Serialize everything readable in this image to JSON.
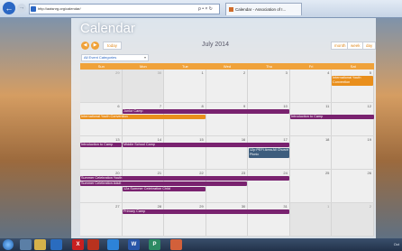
{
  "browser": {
    "back_glyph": "←",
    "forward_glyph": "→",
    "address": "http://aaisnrg.org/calendar/",
    "address_controls": "ρ • × ↻",
    "tab_title": "Calendar - Association of I...",
    "tab_close": "×"
  },
  "page": {
    "title": "Calendar",
    "prev_glyph": "◀",
    "next_glyph": "▶",
    "today_label": "today",
    "month_title": "July 2014",
    "view_month": "month",
    "view_week": "week",
    "view_day": "day",
    "category_value": "All Event Categories",
    "category_chevron": "▾"
  },
  "day_names": [
    "Sun",
    "Mon",
    "Tue",
    "Wed",
    "Thu",
    "Fri",
    "Sat"
  ],
  "weeks": [
    [
      "29",
      "30",
      "1",
      "2",
      "3",
      "4",
      "5"
    ],
    [
      "6",
      "7",
      "8",
      "9",
      "10",
      "11",
      "12"
    ],
    [
      "13",
      "14",
      "15",
      "16",
      "17",
      "18",
      "19"
    ],
    [
      "20",
      "21",
      "22",
      "23",
      "24",
      "25",
      "26"
    ],
    [
      "27",
      "28",
      "29",
      "30",
      "31",
      "1",
      "2"
    ]
  ],
  "events": {
    "international_youth_convention_sat": "International Youth Convention",
    "junior_camp": "Junior Camp",
    "international_youth_convention": "International Youth Convention",
    "introduction_to_camp_fri": "Introduction to Camp",
    "introduction_to_camp_sun": "Introduction to Camp",
    "middle_school_camp": "Middle School Camp",
    "church_picnic": "12p PEFI Area All Church Picnic",
    "summer_celebration_youth": "Summer Celebration Youth",
    "summer_celebration_adult": "Summer Celebration Adult",
    "summer_celebration_child": "12a Summer Celebration Child",
    "primary_camp": "Primary Camp"
  },
  "taskbar": {
    "clock": "Oct"
  },
  "colors": {
    "accent": "#f0a23a",
    "event_purple": "#79226f",
    "event_orange": "#e98f1c",
    "event_blue": "#3d5d7d"
  }
}
